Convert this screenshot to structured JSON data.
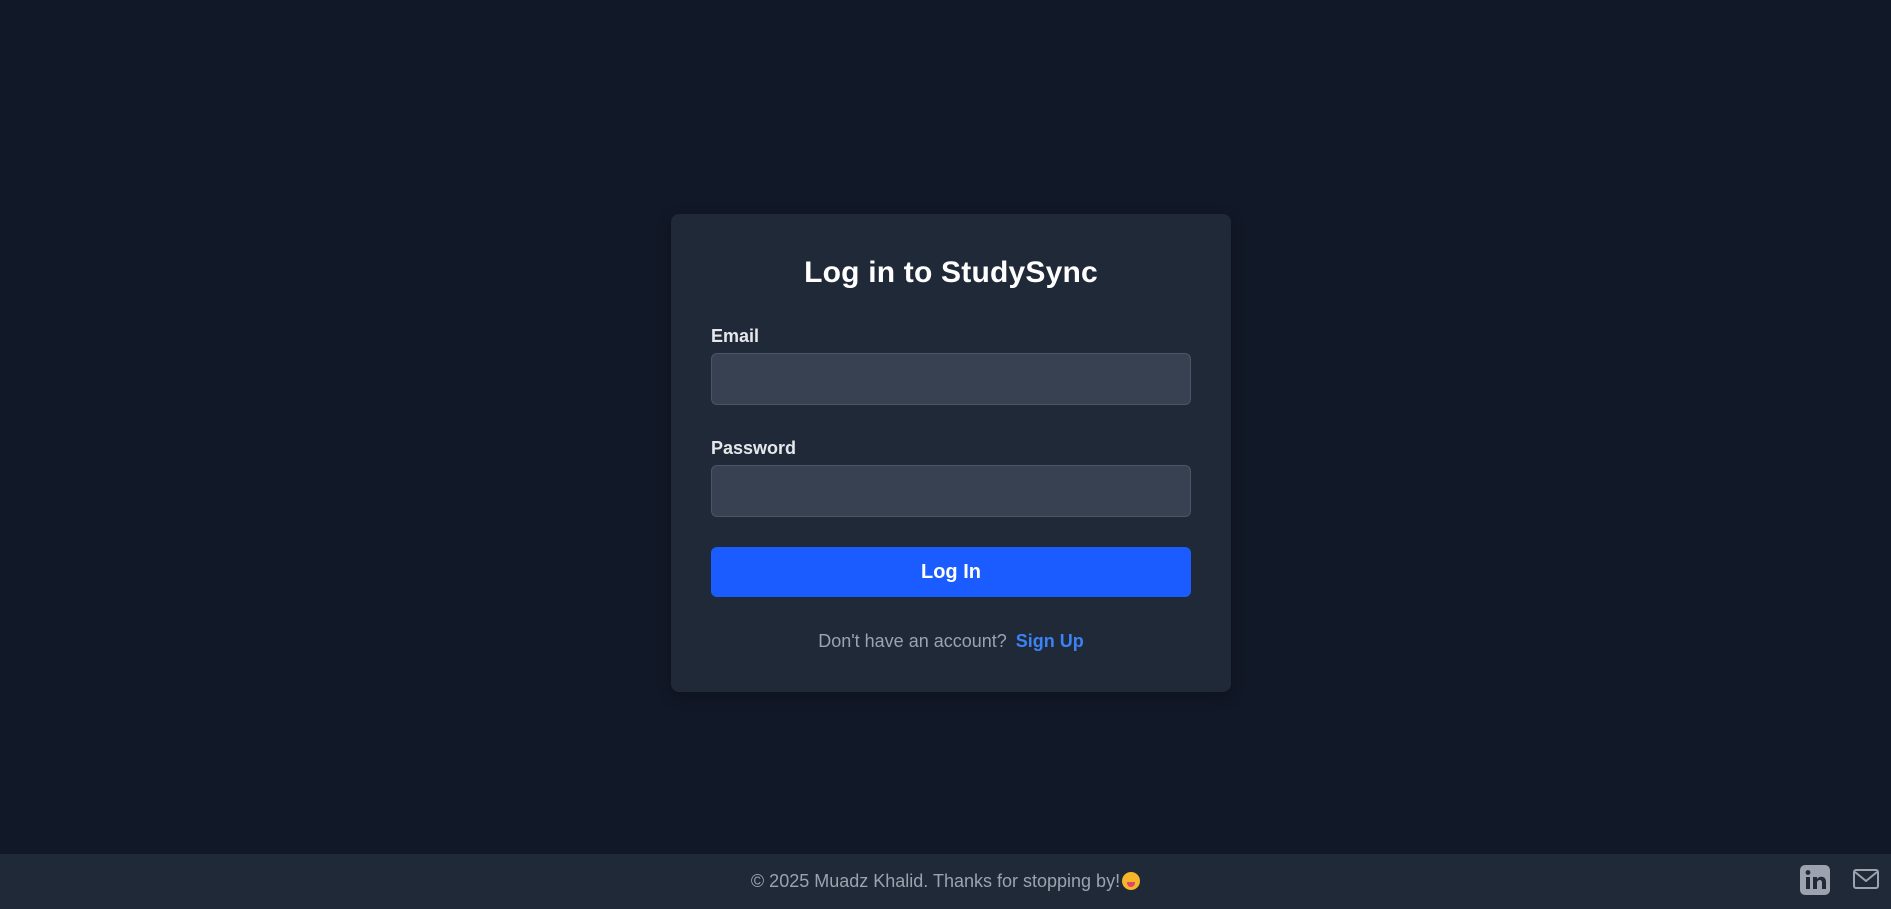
{
  "login": {
    "title": "Log in to StudySync",
    "email_label": "Email",
    "email_value": "",
    "password_label": "Password",
    "password_value": "",
    "submit_label": "Log In",
    "signup_prompt": "Don't have an account?",
    "signup_link": "Sign Up"
  },
  "footer": {
    "text": "© 2025 Muadz Khalid. Thanks for stopping by!",
    "emoji_icon": "tongue-face-emoji",
    "social_icons": [
      "linkedin-icon",
      "mail-icon"
    ]
  },
  "colors": {
    "background": "#111827",
    "card": "#1f2937",
    "input": "#374151",
    "primary": "#1a5cff",
    "link": "#3b82f6",
    "muted_text": "#9ca3af"
  }
}
